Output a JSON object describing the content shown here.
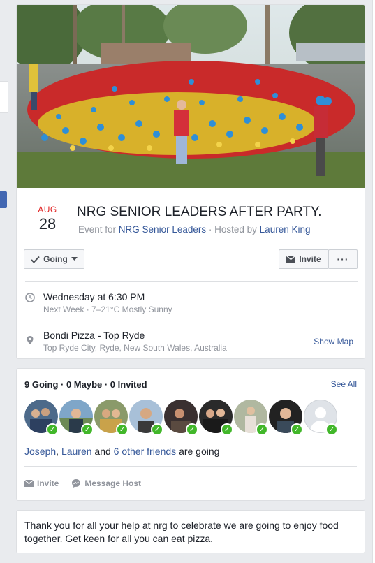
{
  "event": {
    "month": "AUG",
    "day": "28",
    "title": "NRG SENIOR LEADERS AFTER PARTY.",
    "event_for_label": "Event for",
    "group_name": "NRG Senior Leaders",
    "hosted_by_label": "· Hosted by",
    "host_name": "Lauren King",
    "cover_alt": "group photo",
    "colors": {
      "accent_red": "#e02020",
      "link": "#365899",
      "going_green": "#42b72a"
    }
  },
  "actions": {
    "going_label": "Going",
    "invite_label": "Invite",
    "more_label": "···"
  },
  "time": {
    "main": "Wednesday at 6:30 PM",
    "sub": "Next Week · 7–21°C Mostly Sunny",
    "icon": "clock-icon"
  },
  "location": {
    "main": "Bondi Pizza - Top Ryde",
    "sub": "Top Ryde City, Ryde, New South Wales, Australia",
    "show_map": "Show Map",
    "icon": "map-pin-icon"
  },
  "guests": {
    "summary": "9 Going · 0 Maybe · 0 Invited",
    "see_all": "See All",
    "avatars": [
      {
        "name": "guest-1"
      },
      {
        "name": "guest-2"
      },
      {
        "name": "guest-3"
      },
      {
        "name": "guest-4"
      },
      {
        "name": "guest-5"
      },
      {
        "name": "guest-6"
      },
      {
        "name": "guest-7"
      },
      {
        "name": "guest-8"
      },
      {
        "name": "guest-9"
      }
    ],
    "friend_1": "Joseph",
    "sep_1": ",",
    "friend_2": "Lauren",
    "and_label": "and",
    "others_link": "6 other friends",
    "are_going": "are going",
    "invite_label": "Invite",
    "message_host_label": "Message Host"
  },
  "description": {
    "text": "Thank you for all your help at nrg to celebrate we are going to enjoy food together. Get keen for all you can eat pizza."
  }
}
